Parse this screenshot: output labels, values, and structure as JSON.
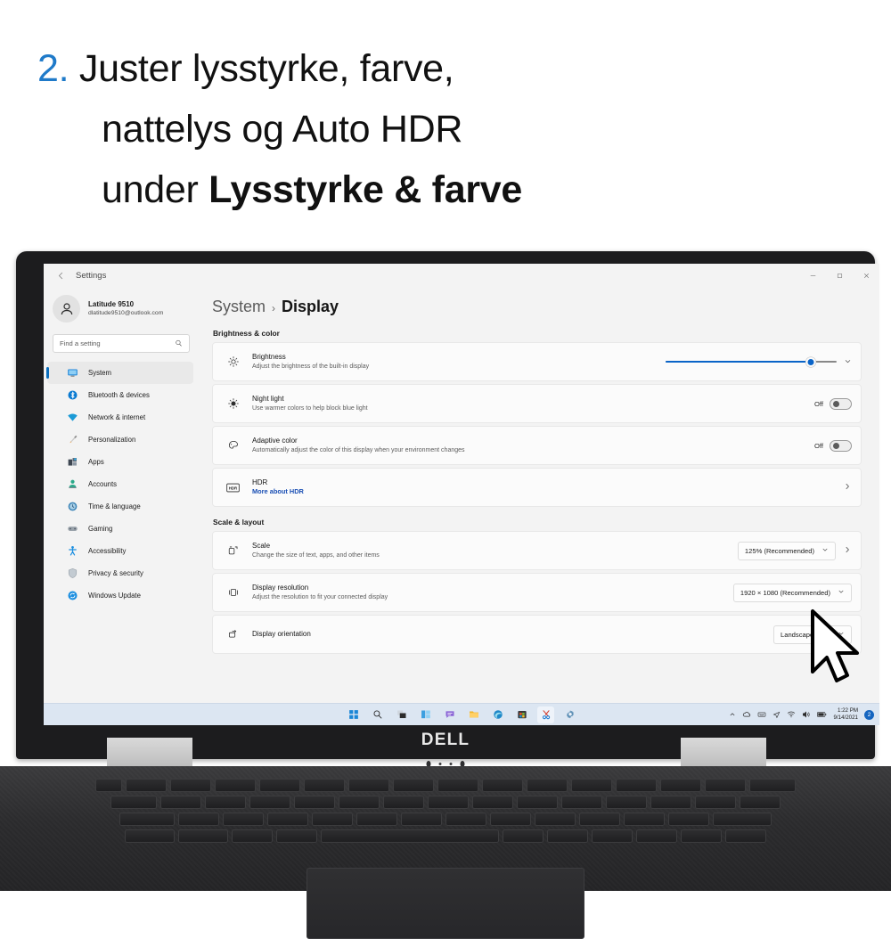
{
  "instruction": {
    "number": "2.",
    "line1": "Juster lysstyrke, farve,",
    "line2": "nattelys og Auto HDR",
    "line3_prefix": "under ",
    "line3_bold": "Lysstyrke & farve",
    "number_color": "#1f7ac9"
  },
  "window": {
    "title": "Settings",
    "back_icon": "back-arrow-icon",
    "controls": {
      "minimize": "–",
      "maximize": "▢",
      "close": "✕"
    }
  },
  "sidebar": {
    "profile": {
      "name": "Latitude 9510",
      "email": "dlatitude9510@outlook.com",
      "avatar_icon": "person-icon"
    },
    "search": {
      "placeholder": "Find a setting",
      "icon": "search-icon"
    },
    "items": [
      {
        "label": "System",
        "icon": "monitor-icon",
        "active": true,
        "color": "#0a84d6"
      },
      {
        "label": "Bluetooth & devices",
        "icon": "bluetooth-icon",
        "active": false,
        "color": "#0a84d6"
      },
      {
        "label": "Network & internet",
        "icon": "wifi-icon",
        "active": false,
        "color": "#1b9ad6"
      },
      {
        "label": "Personalization",
        "icon": "paintbrush-icon",
        "active": false,
        "color": "#e08a2b"
      },
      {
        "label": "Apps",
        "icon": "apps-icon",
        "active": false,
        "color": "#4a5562"
      },
      {
        "label": "Accounts",
        "icon": "accounts-icon",
        "active": false,
        "color": "#2aa98a"
      },
      {
        "label": "Time & language",
        "icon": "clock-globe-icon",
        "active": false,
        "color": "#3f86b8"
      },
      {
        "label": "Gaming",
        "icon": "gamepad-icon",
        "active": false,
        "color": "#8a8a8a"
      },
      {
        "label": "Accessibility",
        "icon": "accessibility-icon",
        "active": false,
        "color": "#1b8ee0"
      },
      {
        "label": "Privacy & security",
        "icon": "shield-icon",
        "active": false,
        "color": "#9aa3ab"
      },
      {
        "label": "Windows Update",
        "icon": "update-icon",
        "active": false,
        "color": "#1b8ee0"
      }
    ]
  },
  "main": {
    "breadcrumb": {
      "parent": "System",
      "separator": "›",
      "current": "Display"
    },
    "sections": [
      {
        "heading": "Brightness & color",
        "rows": [
          {
            "title": "Brightness",
            "subtitle": "Adjust the brightness of the built-in display",
            "icon": "brightness-icon",
            "control": "slider",
            "slider_percent": 85,
            "expand_icon": "chevron-down-icon"
          },
          {
            "title": "Night light",
            "subtitle": "Use warmer colors to help block blue light",
            "icon": "night-light-icon",
            "control": "toggle",
            "toggle_state": "Off"
          },
          {
            "title": "Adaptive color",
            "subtitle": "Automatically adjust the color of this display when your environment changes",
            "icon": "adaptive-color-icon",
            "control": "toggle",
            "toggle_state": "Off"
          },
          {
            "title": "HDR",
            "link": "More about HDR",
            "icon": "hdr-icon",
            "control": "chevron",
            "chevron_icon": "chevron-right-icon"
          }
        ]
      },
      {
        "heading": "Scale & layout",
        "rows": [
          {
            "title": "Scale",
            "subtitle": "Change the size of text, apps, and other items",
            "icon": "scale-icon",
            "control": "combo",
            "combo_value": "125% (Recommended)",
            "combo_icon": "chevron-down-icon",
            "chevron_icon": "chevron-right-icon"
          },
          {
            "title": "Display resolution",
            "subtitle": "Adjust the resolution to fit your connected display",
            "icon": "resolution-icon",
            "control": "combo",
            "combo_value": "1920 × 1080 (Recommended)",
            "combo_icon": "chevron-down-icon"
          },
          {
            "title": "Display orientation",
            "subtitle": "",
            "icon": "orientation-icon",
            "control": "combo",
            "combo_value": "Landscape",
            "combo_icon": "chevron-down-icon"
          }
        ]
      }
    ]
  },
  "taskbar": {
    "icons": [
      {
        "name": "start-icon",
        "label": "Start"
      },
      {
        "name": "search-icon",
        "label": "Search"
      },
      {
        "name": "task-view-icon",
        "label": "Task view"
      },
      {
        "name": "widgets-icon",
        "label": "Widgets"
      },
      {
        "name": "chat-icon",
        "label": "Chat"
      },
      {
        "name": "file-explorer-icon",
        "label": "File Explorer"
      },
      {
        "name": "edge-icon",
        "label": "Microsoft Edge"
      },
      {
        "name": "store-icon",
        "label": "Microsoft Store"
      },
      {
        "name": "snipping-tool-icon",
        "label": "Snipping Tool",
        "active": true
      },
      {
        "name": "settings-icon",
        "label": "Settings"
      }
    ],
    "tray": [
      {
        "name": "chevron-up-icon",
        "glyph": "⌃"
      },
      {
        "name": "onedrive-icon",
        "glyph": "☁"
      },
      {
        "name": "keyboard-icon",
        "glyph": "⌨"
      },
      {
        "name": "location-icon",
        "glyph": "➤"
      },
      {
        "name": "wifi-icon",
        "glyph": "◥"
      },
      {
        "name": "volume-icon",
        "glyph": "🔊"
      },
      {
        "name": "battery-icon",
        "glyph": "▰"
      }
    ],
    "time": "1:22 PM",
    "date": "9/14/2021",
    "notification_count": "2"
  },
  "device": {
    "brand": "DELL"
  }
}
